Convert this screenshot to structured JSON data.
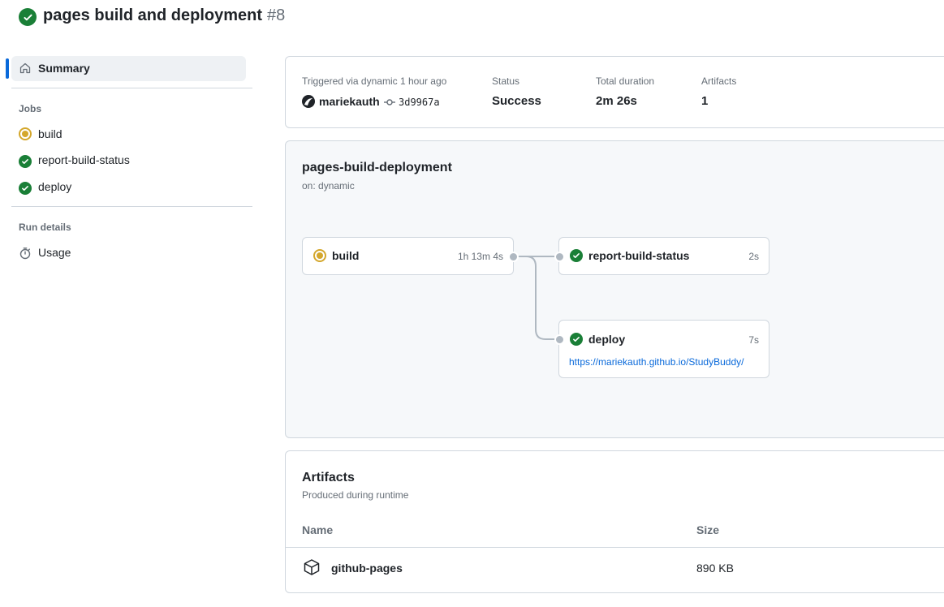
{
  "header": {
    "title": "pages build and deployment",
    "run_number": "#8",
    "status_color": "#1a7f37"
  },
  "sidebar": {
    "summary_label": "Summary",
    "jobs_heading": "Jobs",
    "jobs": [
      {
        "label": "build",
        "status": "in_progress"
      },
      {
        "label": "report-build-status",
        "status": "success"
      },
      {
        "label": "deploy",
        "status": "success"
      }
    ],
    "run_details_heading": "Run details",
    "usage_label": "Usage"
  },
  "summary": {
    "triggered_label": "Triggered via dynamic 1 hour ago",
    "actor": "mariekauth",
    "commit": "3d9967a",
    "status_label": "Status",
    "status_value": "Success",
    "duration_label": "Total duration",
    "duration_value": "2m 26s",
    "artifacts_label": "Artifacts",
    "artifacts_value": "1"
  },
  "workflow": {
    "name": "pages-build-deployment",
    "trigger": "on: dynamic",
    "jobs": {
      "build": {
        "name": "build",
        "time": "1h 13m 4s"
      },
      "report": {
        "name": "report-build-status",
        "time": "2s"
      },
      "deploy": {
        "name": "deploy",
        "time": "7s",
        "url": "https://mariekauth.github.io/StudyBuddy/"
      }
    }
  },
  "artifacts": {
    "title": "Artifacts",
    "subtitle": "Produced during runtime",
    "col_name": "Name",
    "col_size": "Size",
    "items": [
      {
        "name": "github-pages",
        "size": "890 KB"
      }
    ]
  },
  "colors": {
    "success": "#1a7f37",
    "in_progress": "#d4a72c",
    "accent": "#0969da",
    "link": "#0969da"
  }
}
